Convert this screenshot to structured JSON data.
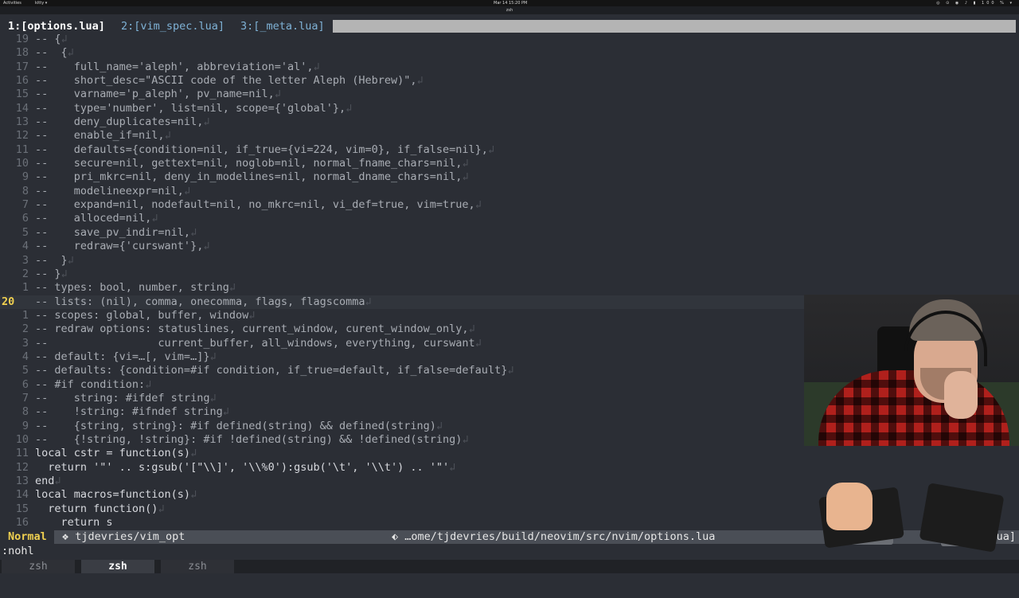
{
  "topbar": {
    "activities": "Activities",
    "app_menu": "kitty ▾",
    "clock": "Mar 14  15:20 PM",
    "status_icons": "◎ ⊙ ◉ ♪ ▮ 100 % ▾"
  },
  "window": {
    "title": "zsh"
  },
  "tabline": {
    "tabs": [
      {
        "label": "1:[options.lua]",
        "active": true
      },
      {
        "label": "2:[vim_spec.lua]",
        "active": false
      },
      {
        "label": "3:[_meta.lua]",
        "active": false
      }
    ]
  },
  "editor": {
    "eol_marker": "↲",
    "lines": [
      {
        "num": "19",
        "text": "-- {",
        "kind": "comment"
      },
      {
        "num": "18",
        "text": "--  {",
        "kind": "comment"
      },
      {
        "num": "17",
        "text": "--    full_name='aleph', abbreviation='al',",
        "kind": "comment"
      },
      {
        "num": "16",
        "text": "--    short_desc=\"ASCII code of the letter Aleph (Hebrew)\",",
        "kind": "comment"
      },
      {
        "num": "15",
        "text": "--    varname='p_aleph', pv_name=nil,",
        "kind": "comment"
      },
      {
        "num": "14",
        "text": "--    type='number', list=nil, scope={'global'},",
        "kind": "comment"
      },
      {
        "num": "13",
        "text": "--    deny_duplicates=nil,",
        "kind": "comment"
      },
      {
        "num": "12",
        "text": "--    enable_if=nil,",
        "kind": "comment"
      },
      {
        "num": "11",
        "text": "--    defaults={condition=nil, if_true={vi=224, vim=0}, if_false=nil},",
        "kind": "comment"
      },
      {
        "num": "10",
        "text": "--    secure=nil, gettext=nil, noglob=nil, normal_fname_chars=nil,",
        "kind": "comment"
      },
      {
        "num": "9",
        "text": "--    pri_mkrc=nil, deny_in_modelines=nil, normal_dname_chars=nil,",
        "kind": "comment"
      },
      {
        "num": "8",
        "text": "--    modelineexpr=nil,",
        "kind": "comment"
      },
      {
        "num": "7",
        "text": "--    expand=nil, nodefault=nil, no_mkrc=nil, vi_def=true, vim=true,",
        "kind": "comment"
      },
      {
        "num": "6",
        "text": "--    alloced=nil,",
        "kind": "comment"
      },
      {
        "num": "5",
        "text": "--    save_pv_indir=nil,",
        "kind": "comment"
      },
      {
        "num": "4",
        "text": "--    redraw={'curswant'},",
        "kind": "comment"
      },
      {
        "num": "3",
        "text": "--  }",
        "kind": "comment"
      },
      {
        "num": "2",
        "text": "-- }",
        "kind": "comment"
      },
      {
        "num": "1",
        "text": "-- types: bool, number, string",
        "kind": "comment"
      },
      {
        "num": "20",
        "text": "-- lists: (nil), comma, onecomma, flags, flagscomma",
        "kind": "comment",
        "current": true
      },
      {
        "num": "1",
        "text": "-- scopes: global, buffer, window",
        "kind": "comment"
      },
      {
        "num": "2",
        "text": "-- redraw options: statuslines, current_window, curent_window_only,",
        "kind": "comment"
      },
      {
        "num": "3",
        "text": "--                 current_buffer, all_windows, everything, curswant",
        "kind": "comment"
      },
      {
        "num": "4",
        "text": "-- default: {vi=…[, vim=…]}",
        "kind": "comment"
      },
      {
        "num": "5",
        "text": "-- defaults: {condition=#if condition, if_true=default, if_false=default}",
        "kind": "comment"
      },
      {
        "num": "6",
        "text": "-- #if condition:",
        "kind": "comment"
      },
      {
        "num": "7",
        "text": "--    string: #ifdef string",
        "kind": "comment"
      },
      {
        "num": "8",
        "text": "--    !string: #ifndef string",
        "kind": "comment"
      },
      {
        "num": "9",
        "text": "--    {string, string}: #if defined(string) && defined(string)",
        "kind": "comment"
      },
      {
        "num": "10",
        "text": "--    {!string, !string}: #if !defined(string) && !defined(string)",
        "kind": "comment"
      },
      {
        "num": "11",
        "text": "local cstr = function(s)",
        "kind": "code"
      },
      {
        "num": "12",
        "text": "  return '\"' .. s:gsub('[\"\\\\]', '\\\\%0'):gsub('\\t', '\\\\t') .. '\"'",
        "kind": "code"
      },
      {
        "num": "13",
        "text": "end",
        "kind": "code"
      },
      {
        "num": "14",
        "text": "local macros=function(s)",
        "kind": "code"
      },
      {
        "num": "15",
        "text": "  return function()",
        "kind": "code"
      },
      {
        "num": "16",
        "text": "    return s",
        "kind": "code"
      }
    ]
  },
  "statusline": {
    "mode": "Normal",
    "branch": "❖ tjdevries/vim_opt",
    "file": "⬖ …ome/tjdevries/build/neovim/src/nvim/options.lua",
    "right": "lua]"
  },
  "cmdline": ":nohl",
  "bottombar": {
    "tabs": [
      {
        "label": "zsh",
        "active": false
      },
      {
        "label": "zsh",
        "active": true
      },
      {
        "label": "zsh",
        "active": false
      }
    ]
  }
}
